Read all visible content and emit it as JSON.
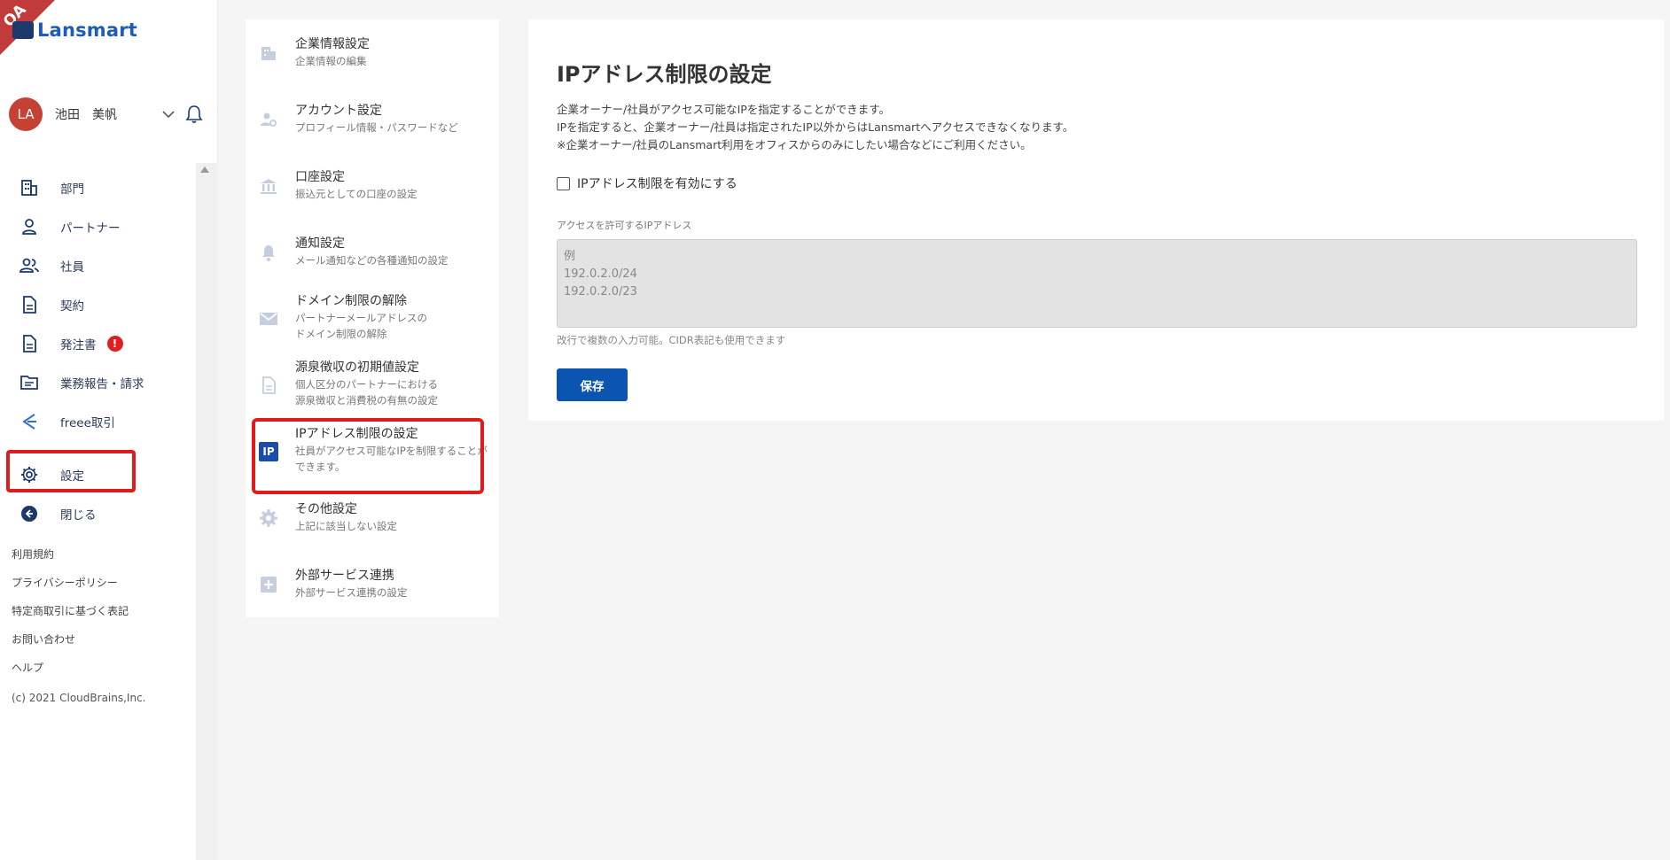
{
  "badge": {
    "qa": "QA"
  },
  "app": {
    "logo_text": "Lansmart"
  },
  "user": {
    "avatar_initials": "LA",
    "name": "池田　美帆"
  },
  "nav": {
    "items": [
      {
        "label": "部門",
        "icon": "building-icon"
      },
      {
        "label": "パートナー",
        "icon": "person-icon"
      },
      {
        "label": "社員",
        "icon": "people-icon"
      },
      {
        "label": "契約",
        "icon": "document-icon"
      },
      {
        "label": "発注書",
        "icon": "document-icon",
        "badge": "!"
      },
      {
        "label": "業務報告・請求",
        "icon": "folder-icon"
      },
      {
        "label": "freee取引",
        "icon": "freee-icon"
      },
      {
        "label": "設定",
        "icon": "gear-icon"
      },
      {
        "label": "閉じる",
        "icon": "back-circle-icon"
      }
    ]
  },
  "footer": {
    "links": [
      "利用規約",
      "プライバシーポリシー",
      "特定商取引に基づく表記",
      "お問い合わせ",
      "ヘルプ"
    ],
    "copyright": "(c) 2021 CloudBrains,Inc."
  },
  "settings_menu": {
    "items": [
      {
        "title": "企業情報設定",
        "desc": "企業情報の編集",
        "icon": "building-icon"
      },
      {
        "title": "アカウント設定",
        "desc": "プロフィール情報・パスワードなど",
        "icon": "user-gear-icon"
      },
      {
        "title": "口座設定",
        "desc": "振込元としての口座の設定",
        "icon": "bank-icon"
      },
      {
        "title": "通知設定",
        "desc": "メール通知などの各種通知の設定",
        "icon": "bell-icon"
      },
      {
        "title": "ドメイン制限の解除",
        "desc": "パートナーメールアドレスの\nドメイン制限の解除",
        "icon": "mail-icon"
      },
      {
        "title": "源泉徴収の初期値設定",
        "desc": "個人区分のパートナーにおける\n源泉徴収と消費税の有無の設定",
        "icon": "document-icon"
      },
      {
        "title": "IPアドレス制限の設定",
        "desc": "社員がアクセス可能なIPを制限することができます。",
        "icon": "ip-icon",
        "icon_text": "IP"
      },
      {
        "title": "その他設定",
        "desc": "上記に該当しない設定",
        "icon": "gear-icon"
      },
      {
        "title": "外部サービス連携",
        "desc": "外部サービス連携の設定",
        "icon": "plus-square-icon"
      }
    ]
  },
  "main": {
    "title": "IPアドレス制限の設定",
    "description": [
      "企業オーナー/社員がアクセス可能なIPを指定することができます。",
      "IPを指定すると、企業オーナー/社員は指定されたIP以外からはLansmartへアクセスできなくなります。",
      "※企業オーナー/社員のLansmart利用をオフィスからのみにしたい場合などにご利用ください。"
    ],
    "checkbox_label": "IPアドレス制限を有効にする",
    "field_label": "アクセスを許可するIPアドレス",
    "textarea_placeholder": "例\n192.0.2.0/24\n192.0.2.0/23",
    "hint": "改行で複数の入力可能。CIDR表記も使用できます",
    "save_label": "保存"
  },
  "colors": {
    "accent": "#0b54b0",
    "highlight": "#e01b1b",
    "avatar": "#c44134"
  }
}
